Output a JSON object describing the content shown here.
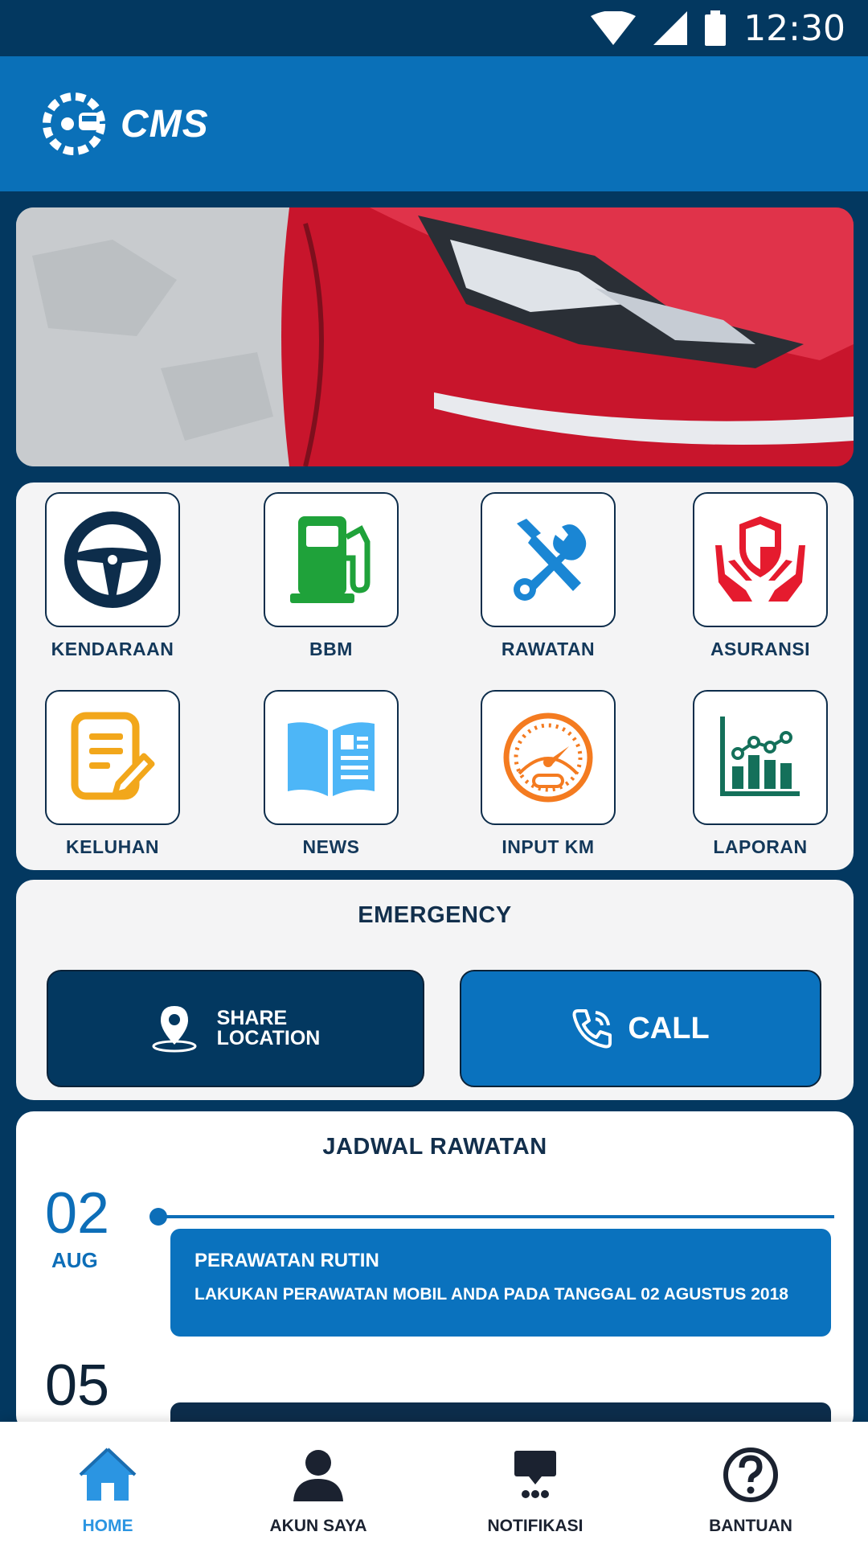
{
  "status_bar": {
    "time": "12:30",
    "icons": [
      "wifi-icon",
      "signal-icon",
      "battery-icon"
    ]
  },
  "app_bar": {
    "brand": "CMS",
    "logo": "steering-wheel-car-logo"
  },
  "hero": {
    "image": "red-car-headlight-photo"
  },
  "menu": [
    {
      "label": "KENDARAAN",
      "icon": "steering-wheel-icon",
      "color": "#0d2d4b"
    },
    {
      "label": "BBM",
      "icon": "fuel-pump-icon",
      "color": "#1fa23a"
    },
    {
      "label": "RAWATAN",
      "icon": "tools-icon",
      "color": "#1a86d4"
    },
    {
      "label": "ASURANSI",
      "icon": "insurance-shield-icon",
      "color": "#e51b2e"
    },
    {
      "label": "KELUHAN",
      "icon": "complaint-note-icon",
      "color": "#f2a71b"
    },
    {
      "label": "NEWS",
      "icon": "news-book-icon",
      "color": "#4db6f7"
    },
    {
      "label": "INPUT KM",
      "icon": "speedometer-icon",
      "color": "#f47b20"
    },
    {
      "label": "LAPORAN",
      "icon": "report-chart-icon",
      "color": "#14705a"
    }
  ],
  "emergency": {
    "title": "EMERGENCY",
    "share_line1": "SHARE",
    "share_line2": "LOCATION",
    "call_label": "CALL"
  },
  "schedule": {
    "title": "JADWAL RAWATAN",
    "items": [
      {
        "day": "02",
        "month": "AUG",
        "title": "PERAWATAN RUTIN",
        "description": "LAKUKAN PERAWATAN MOBIL ANDA PADA TANGGAL 02 AGUSTUS 2018"
      },
      {
        "day": "05"
      }
    ]
  },
  "bottom_nav": [
    {
      "label": "HOME",
      "icon": "home-icon",
      "active": true
    },
    {
      "label": "AKUN SAYA",
      "icon": "user-icon",
      "active": false
    },
    {
      "label": "NOTIFIKASI",
      "icon": "notification-icon",
      "active": false
    },
    {
      "label": "BANTUAN",
      "icon": "help-icon",
      "active": false
    }
  ],
  "colors": {
    "primary_dark": "#033860",
    "primary": "#0a70b8",
    "accent_active": "#2b95e2"
  }
}
